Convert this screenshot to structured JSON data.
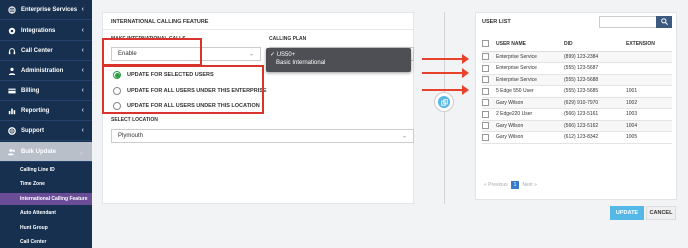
{
  "sidebar": {
    "items": [
      {
        "label": "Enterprise Services",
        "icon": "globe-icon"
      },
      {
        "label": "Integrations",
        "icon": "plug-icon"
      },
      {
        "label": "Call Center",
        "icon": "headset-icon"
      },
      {
        "label": "Administration",
        "icon": "user-icon"
      },
      {
        "label": "Billing",
        "icon": "card-icon"
      },
      {
        "label": "Reporting",
        "icon": "chart-icon"
      },
      {
        "label": "Support",
        "icon": "lifebuoy-icon"
      },
      {
        "label": "Bulk Update",
        "icon": "users-icon"
      }
    ],
    "sub_items": [
      {
        "label": "Calling Line ID"
      },
      {
        "label": "Time Zone"
      },
      {
        "label": "International Calling Feature"
      },
      {
        "label": "Auto Attendant"
      },
      {
        "label": "Hunt Group"
      },
      {
        "label": "Call Center"
      }
    ]
  },
  "feature": {
    "title": "INTERNATIONAL CALLING FEATURE",
    "make_calls_label": "MAKE INTERNATIONAL CALLS",
    "make_calls_value": "Enable",
    "calling_plan_label": "CALLING PLAN",
    "plan_options": [
      "✓ US50+",
      "Basic International"
    ],
    "radio_options": [
      "UPDATE FOR SELECTED USERS",
      "UPDATE FOR ALL USERS UNDER THIS ENTERPRISE",
      "UPDATE FOR ALL USERS UNDER THIS LOCATION"
    ],
    "select_location_label": "SELECT LOCATION",
    "location_value": "Plymouth"
  },
  "user_list": {
    "title": "USER LIST",
    "columns": [
      "USER NAME",
      "DID",
      "EXTENSION"
    ],
    "rows": [
      {
        "name": "Enterprise Service",
        "did": "(899) 123-2384",
        "ext": ""
      },
      {
        "name": "Enterprise Service",
        "did": "(555) 123-5687",
        "ext": ""
      },
      {
        "name": "Enterprise Service",
        "did": "(555) 123-5688",
        "ext": ""
      },
      {
        "name": "5 Edge 550 User",
        "did": "(555) 123-5685",
        "ext": "1001"
      },
      {
        "name": "Gary Wilson",
        "did": "(629) 910-7970",
        "ext": "1002"
      },
      {
        "name": "2 Edge220 User",
        "did": "(566) 123-5161",
        "ext": "1003"
      },
      {
        "name": "Gary Wilson",
        "did": "(566) 123-5162",
        "ext": "1004"
      },
      {
        "name": "Gary Wilson",
        "did": "(612) 123-8342",
        "ext": "1005"
      }
    ],
    "pager": {
      "prev": "« Previous",
      "page": "1",
      "next": "Next »"
    }
  },
  "actions": {
    "update": "UPDATE",
    "cancel": "CANCEL"
  },
  "colors": {
    "sidebar": "#17304f",
    "accent": "#55b8e6",
    "highlight": "#d9342b",
    "selected_sub": "#6a4c97"
  }
}
